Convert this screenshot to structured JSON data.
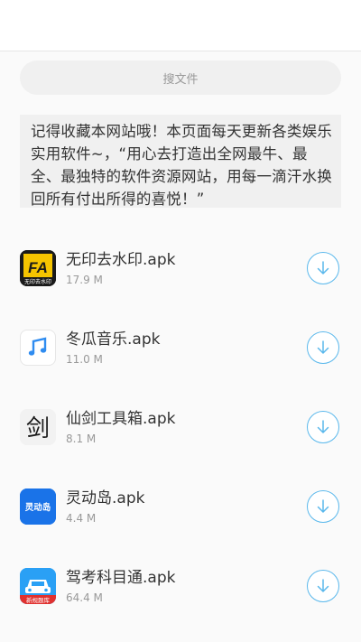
{
  "search": {
    "placeholder": "搜文件"
  },
  "notice": {
    "text": "记得收藏本网站哦！本页面每天更新各类娱乐实用软件~，“用心去打造出全网最牛、最全、最独特的软件资源网站，用每一滴汗水换回所有付出所得的喜悦！”"
  },
  "files": [
    {
      "name": "无印去水印.apk",
      "size": "17.9 M",
      "icon": "no-watermark-app-icon",
      "icon_text": "无印去水印"
    },
    {
      "name": "冬瓜音乐.apk",
      "size": "11.0 M",
      "icon": "music-note-app-icon"
    },
    {
      "name": "仙剑工具箱.apk",
      "size": "8.1 M",
      "icon": "sword-calligraphy-app-icon",
      "icon_text": "剑"
    },
    {
      "name": "灵动岛.apk",
      "size": "4.4 M",
      "icon": "dynamic-island-app-icon",
      "icon_text": "灵动岛"
    },
    {
      "name": "驾考科目通.apk",
      "size": "64.4 M",
      "icon": "car-driving-test-app-icon",
      "icon_text": "新规题库"
    }
  ],
  "colors": {
    "accent": "#5ab8ec",
    "search_bg": "#f0f0f0",
    "text": "#333333",
    "muted": "#999999"
  }
}
